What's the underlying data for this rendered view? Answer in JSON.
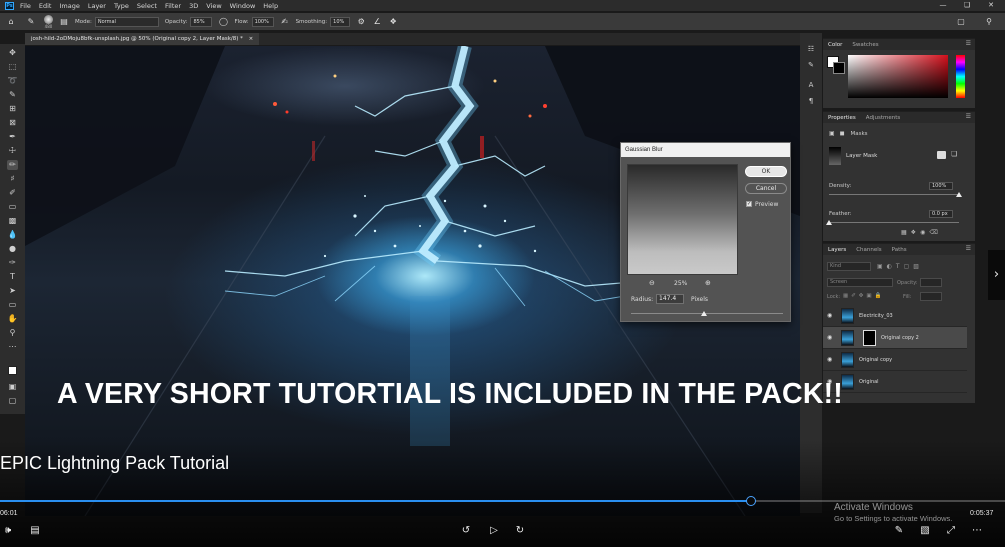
{
  "app": {
    "logo": "Ps",
    "menus": [
      "File",
      "Edit",
      "Image",
      "Layer",
      "Type",
      "Select",
      "Filter",
      "3D",
      "View",
      "Window",
      "Help"
    ]
  },
  "options_bar": {
    "brush_size": "480",
    "mode_label": "Mode:",
    "mode_value": "Normal",
    "opacity_label": "Opacity:",
    "opacity_value": "85%",
    "flow_label": "Flow:",
    "flow_value": "100%",
    "smoothing_label": "Smoothing:",
    "smoothing_value": "10%"
  },
  "document": {
    "tab_title": "josh-hild-2oDMoju8bfk-unsplash.jpg @ 50% (Original copy 2, Layer Mask/8) *"
  },
  "color_panel": {
    "tabs": [
      "Color",
      "Swatches"
    ],
    "foreground": "#ffffff",
    "background": "#000000",
    "hue_color": "#d4101c"
  },
  "properties_panel": {
    "tabs": [
      "Properties",
      "Adjustments"
    ],
    "masks_label": "Masks",
    "layer_mask_label": "Layer Mask",
    "density_label": "Density:",
    "density_value": "100%",
    "density_level": 1.0,
    "feather_label": "Feather:",
    "feather_value": "0.0 px",
    "feather_level": 0.0
  },
  "layers_panel": {
    "tabs": [
      "Layers",
      "Channels",
      "Paths"
    ],
    "kind_placeholder": "Kind",
    "blend_mode": "Screen",
    "opacity_label": "Opacity:",
    "lock_label": "Lock:",
    "fill_label": "Fill:",
    "layers": [
      {
        "name": "Electricity_03",
        "selected": false,
        "has_mask": false
      },
      {
        "name": "Original copy 2",
        "selected": true,
        "has_mask": true
      },
      {
        "name": "Original copy",
        "selected": false,
        "has_mask": false
      },
      {
        "name": "Original",
        "selected": false,
        "has_mask": false
      }
    ]
  },
  "gaussian_dialog": {
    "title": "Gaussian Blur",
    "ok_label": "OK",
    "cancel_label": "Cancel",
    "preview_label": "Preview",
    "zoom_value": "25%",
    "radius_label": "Radius:",
    "radius_value": "147.4",
    "radius_unit": "Pixels",
    "radius_slider_level": 0.5
  },
  "video": {
    "caption": "A VERY SHORT TUTORTIAL IS INCLUDED IN THE PACK!!",
    "title": "EPIC Lightning Pack Tutorial",
    "current_time": "06:01",
    "total_time": "0:05:37",
    "progress": 0.747,
    "accent": "#2a8ff0"
  },
  "watermark": {
    "line1": "Activate Windows",
    "line2": "Go to Settings to activate Windows."
  },
  "icons": [
    "home-icon",
    "brush-icon",
    "gear-icon",
    "search-icon",
    "play-icon",
    "rewind-10-icon",
    "forward-30-icon",
    "volume-icon",
    "captions-icon",
    "fullscreen-icon",
    "eye-icon",
    "zoom-in-icon",
    "zoom-out-icon"
  ]
}
